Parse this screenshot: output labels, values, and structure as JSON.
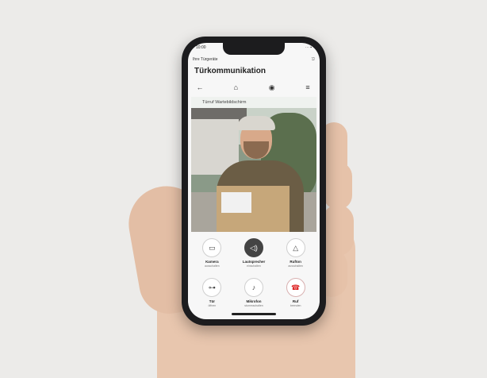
{
  "status": {
    "time": "10:00",
    "signal": "⋯ ▪"
  },
  "nav": {
    "back_label": "Ihre Türgeräte",
    "edit": "⎋"
  },
  "page": {
    "title": "Türkommunikation"
  },
  "toolbar": [
    {
      "icon": "arrow-left-icon",
      "glyph": "←"
    },
    {
      "icon": "home-icon",
      "glyph": "⌂"
    },
    {
      "icon": "settings-icon",
      "glyph": "◉"
    },
    {
      "icon": "menu-icon",
      "glyph": "≡"
    }
  ],
  "video": {
    "overlay": "Türruf  Wartebildschirm"
  },
  "controls": [
    {
      "name": "Kamera",
      "sub": "ausschalten",
      "glyph": "▭",
      "icon": "camera-icon",
      "state": "normal"
    },
    {
      "name": "Lautsprecher",
      "sub": "einschalten",
      "glyph": "◁)",
      "icon": "speaker-icon",
      "state": "active"
    },
    {
      "name": "Rufton",
      "sub": "ausschalten",
      "glyph": "△",
      "icon": "bell-icon",
      "state": "normal"
    },
    {
      "name": "Tür",
      "sub": "öffnen",
      "glyph": "⊶",
      "icon": "key-icon",
      "state": "normal"
    },
    {
      "name": "Mikrofon",
      "sub": "stummschalten",
      "glyph": "♪",
      "icon": "microphone-icon",
      "state": "normal"
    },
    {
      "name": "Ruf",
      "sub": "beenden",
      "glyph": "☎",
      "icon": "hangup-icon",
      "state": "red"
    }
  ]
}
